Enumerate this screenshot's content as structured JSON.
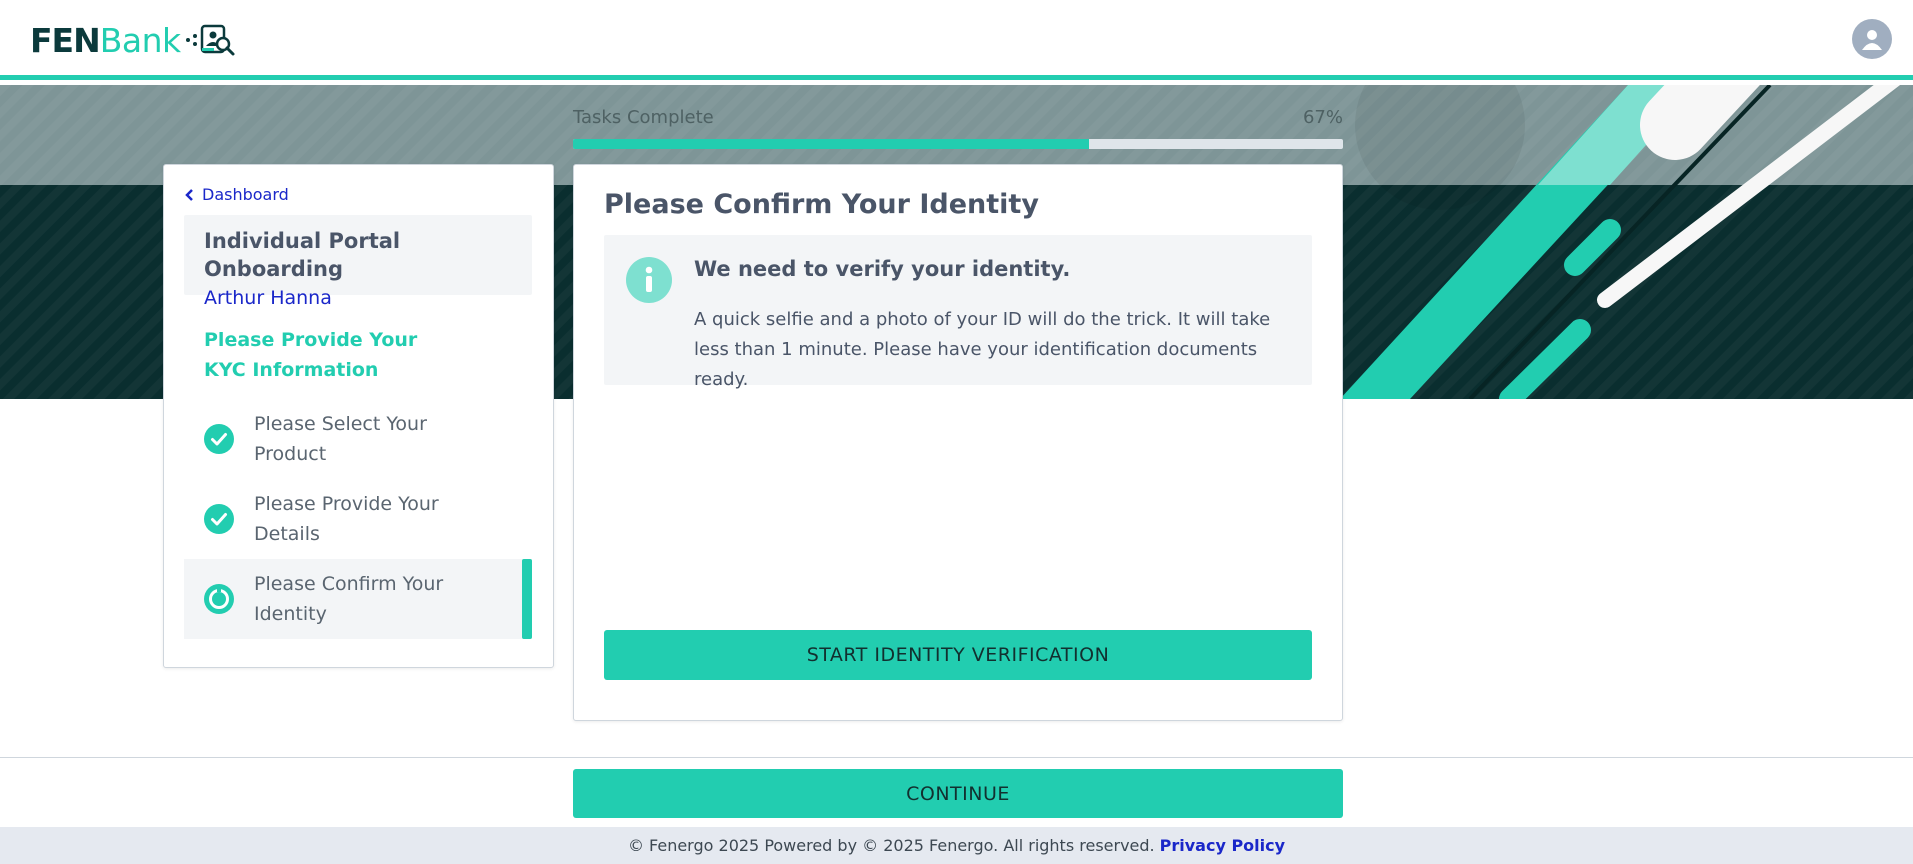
{
  "brand": {
    "name_part1": "FEN",
    "name_part2": "Bank",
    "logo_icon": "id-scan-icon",
    "accent": "#22cdb0",
    "dark": "#0a2e2f",
    "link": "#1a27c9"
  },
  "header": {
    "avatar_icon": "user-icon"
  },
  "progress": {
    "label": "Tasks Complete",
    "percent_text": "67%",
    "value": 0.67
  },
  "nav": {
    "back_label": "Dashboard",
    "onboarding_title": "Individual Portal Onboarding",
    "user_name": "Arthur Hanna",
    "section_title": "Please Provide Your KYC Information",
    "steps": [
      {
        "label": "Please Select Your Product",
        "status": "complete",
        "icon": "check-circle-icon"
      },
      {
        "label": "Please Provide Your Details",
        "status": "complete",
        "icon": "check-circle-icon"
      },
      {
        "label": "Please Confirm Your Identity",
        "status": "in-progress",
        "icon": "in-progress-icon"
      }
    ]
  },
  "main": {
    "title": "Please Confirm Your Identity",
    "info_icon": "info-icon",
    "info_heading": "We need to verify your identity.",
    "info_body": "A quick selfie and a photo of your ID will do the trick. It will take less than 1 minute. Please have your identification documents ready.",
    "verify_button": "START IDENTITY VERIFICATION"
  },
  "footer": {
    "continue_button": "CONTINUE",
    "copyright": "© Fenergo 2025 Powered by © 2025 Fenergo. All rights reserved.",
    "privacy_link": "Privacy Policy"
  }
}
